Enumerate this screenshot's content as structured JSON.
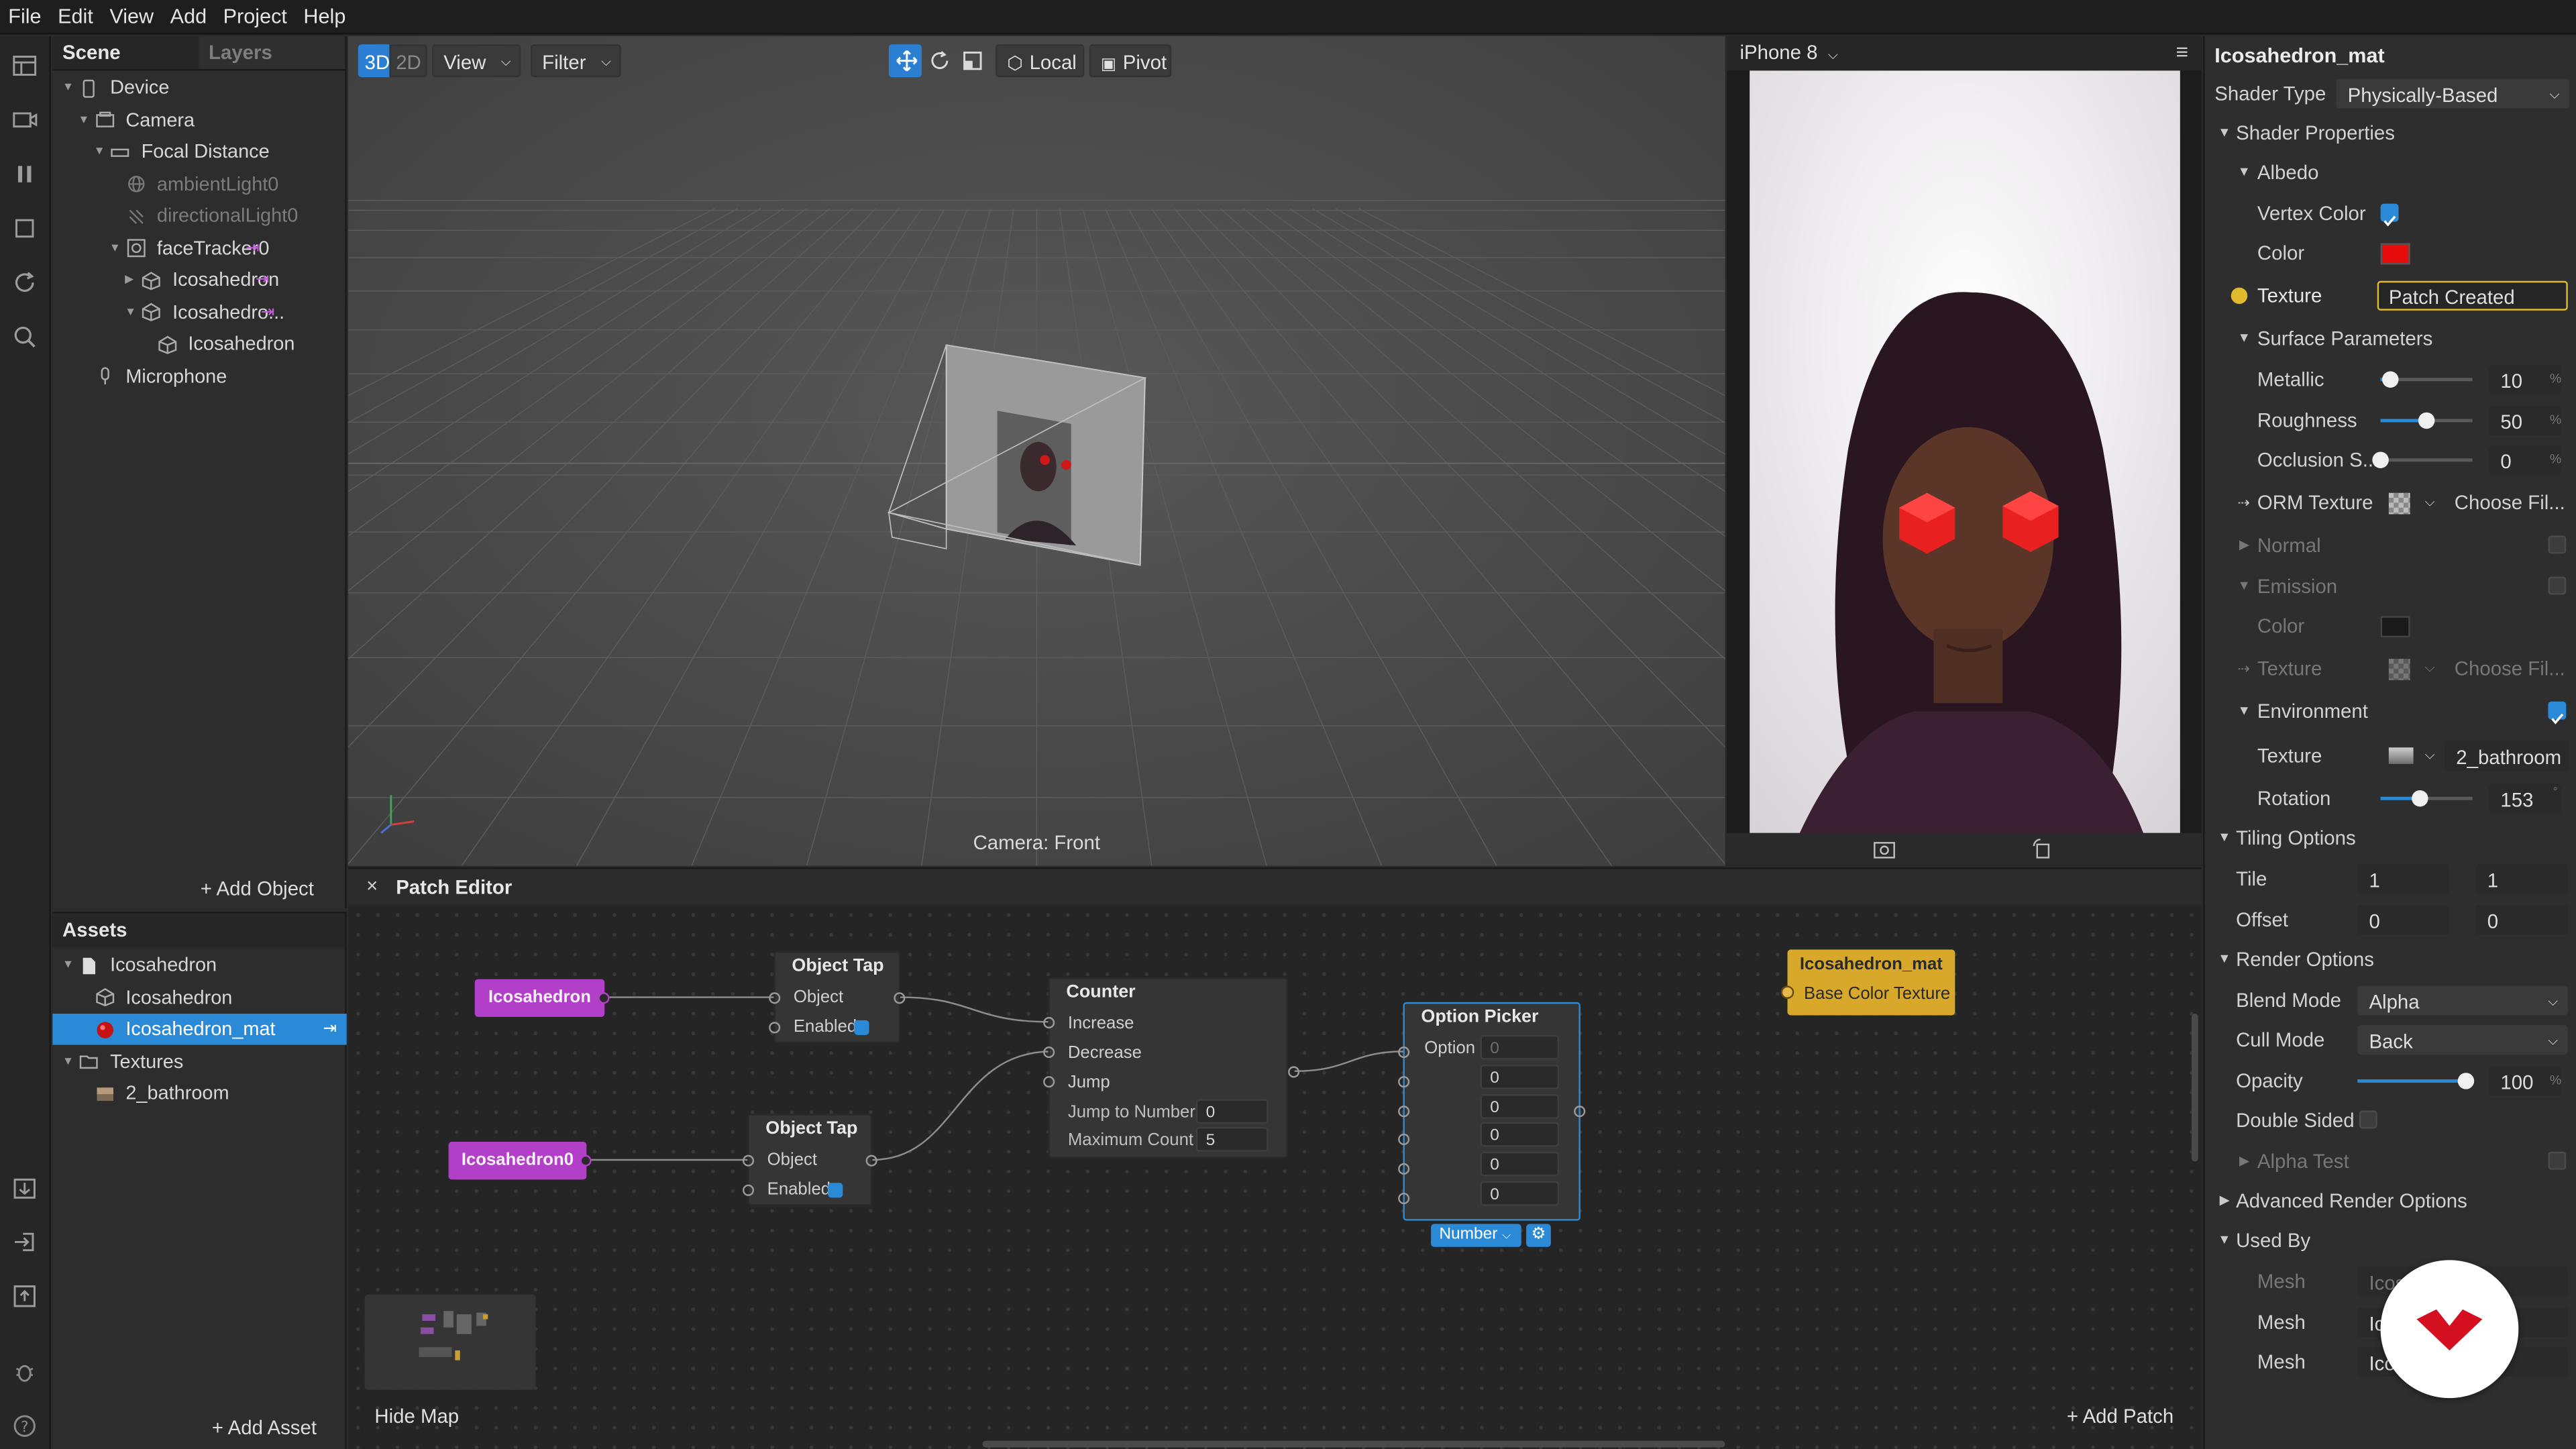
{
  "menu": [
    "File",
    "Edit",
    "View",
    "Add",
    "Project",
    "Help"
  ],
  "scene_panel": {
    "tabs": [
      "Scene",
      "Layers"
    ],
    "tree": [
      {
        "label": "Device",
        "level": 0,
        "arrow": "down",
        "icon": "device-icon",
        "dim": false
      },
      {
        "label": "Camera",
        "level": 1,
        "arrow": "down",
        "icon": "camera-icon",
        "dim": false
      },
      {
        "label": "Focal Distance",
        "level": 2,
        "arrow": "down",
        "icon": "focal-distance-icon",
        "dim": false
      },
      {
        "label": "ambientLight0",
        "level": 3,
        "arrow": "",
        "icon": "ambient-light-icon",
        "dim": true
      },
      {
        "label": "directionalLight0",
        "level": 3,
        "arrow": "",
        "icon": "directional-light-icon",
        "dim": true
      },
      {
        "label": "faceTracker0",
        "level": 3,
        "arrow": "down",
        "icon": "face-tracker-icon",
        "dim": false,
        "link": true
      },
      {
        "label": "Icosahedron",
        "level": 4,
        "arrow": "right",
        "icon": "mesh-icon",
        "dim": false,
        "link": true
      },
      {
        "label": "Icosahedro...",
        "level": 4,
        "arrow": "down",
        "icon": "mesh-icon",
        "dim": false,
        "link": true
      },
      {
        "label": "Icosahedron",
        "level": 5,
        "arrow": "",
        "icon": "mesh-icon",
        "dim": false
      },
      {
        "label": "Microphone",
        "level": 1,
        "arrow": "",
        "icon": "microphone-icon",
        "dim": false
      }
    ],
    "add_object": "Add Object"
  },
  "viewport": {
    "mode_3d": "3D",
    "mode_2d": "2D",
    "view_menu": "View",
    "filter_menu": "Filter",
    "local_label": "Local",
    "pivot_label": "Pivot",
    "camera_label": "Camera: Front"
  },
  "preview": {
    "device": "iPhone 8"
  },
  "assets_panel": {
    "title": "Assets",
    "items": [
      {
        "label": "Icosahedron",
        "level": 0,
        "arrow": "down",
        "icon": "file-icon"
      },
      {
        "label": "Icosahedron",
        "level": 1,
        "arrow": "",
        "icon": "mesh-icon"
      },
      {
        "label": "Icosahedron_mat",
        "level": 1,
        "arrow": "",
        "icon": "material-icon",
        "selected": true,
        "link": true
      },
      {
        "label": "Textures",
        "level": 0,
        "arrow": "down",
        "icon": "folder-icon"
      },
      {
        "label": "2_bathroom",
        "level": 1,
        "arrow": "",
        "icon": "texture-icon"
      }
    ],
    "add_asset": "Add Asset"
  },
  "patch_editor": {
    "title": "Patch Editor",
    "hide_map": "Hide Map",
    "add_patch": "Add Patch",
    "nodes": {
      "icosahedron": "Icosahedron",
      "icosahedron0": "Icosahedron0",
      "object_tap_1": {
        "title": "Object Tap",
        "object": "Object",
        "enabled": "Enabled"
      },
      "object_tap_2": {
        "title": "Object Tap",
        "object": "Object",
        "enabled": "Enabled"
      },
      "counter": {
        "title": "Counter",
        "increase": "Increase",
        "decrease": "Decrease",
        "jump": "Jump",
        "jump_to_number": "Jump to Number",
        "jump_to_number_value": "0",
        "maximum_count": "Maximum Count",
        "maximum_count_value": "5"
      },
      "option_picker": {
        "title": "Option Picker",
        "option": "Option",
        "option_value": "0",
        "values": [
          "0",
          "0",
          "0",
          "0",
          "0"
        ],
        "type": "Number"
      },
      "material": {
        "title": "Icosahedron_mat",
        "port": "Base Color Texture"
      }
    }
  },
  "inspector": {
    "title": "Icosahedron_mat",
    "shader_type_label": "Shader Type",
    "shader_type_value": "Physically-Based",
    "shader_properties": "Shader Properties",
    "albedo": "Albedo",
    "vertex_color": "Vertex Color",
    "color": "Color",
    "texture": "Texture",
    "texture_value": "Patch Created",
    "surface_parameters": "Surface Parameters",
    "metallic": "Metallic",
    "metallic_value": "10",
    "roughness": "Roughness",
    "roughness_value": "50",
    "occlusion": "Occlusion S...",
    "occlusion_value": "0",
    "orm_texture": "ORM Texture",
    "choose_file": "Choose Fil...",
    "normal": "Normal",
    "emission": "Emission",
    "emission_color": "Color",
    "emission_texture": "Texture",
    "emission_choose_file": "Choose Fil...",
    "environment": "Environment",
    "env_texture": "Texture",
    "env_texture_value": "2_bathroom",
    "rotation": "Rotation",
    "rotation_value": "153",
    "tiling_options": "Tiling Options",
    "tile": "Tile",
    "tile_x": "1",
    "tile_y": "1",
    "offset": "Offset",
    "offset_x": "0",
    "offset_y": "0",
    "render_options": "Render Options",
    "blend_mode": "Blend Mode",
    "blend_mode_value": "Alpha",
    "cull_mode": "Cull Mode",
    "cull_mode_value": "Back",
    "opacity": "Opacity",
    "opacity_value": "100",
    "double_sided": "Double Sided",
    "alpha_test": "Alpha Test",
    "advanced_render_options": "Advanced Render Options",
    "used_by": "Used By",
    "used_by_rows": [
      {
        "label": "Mesh",
        "value": "Icos",
        "dim": true
      },
      {
        "label": "Mesh",
        "value": "Ico",
        "dim": false
      },
      {
        "label": "Mesh",
        "value": "Icos",
        "dim": false
      }
    ],
    "percent_sign": "%",
    "colors": {
      "albedo": "#e80c0c",
      "emission": "#1a1a1a",
      "accent": "#2b8ad8",
      "patch_highlight": "#e0b92c"
    }
  },
  "levels": {
    "metallic": 0.1,
    "roughness": 0.5,
    "occlusion": 0.0,
    "rotation": 0.42,
    "opacity": 1.0
  }
}
